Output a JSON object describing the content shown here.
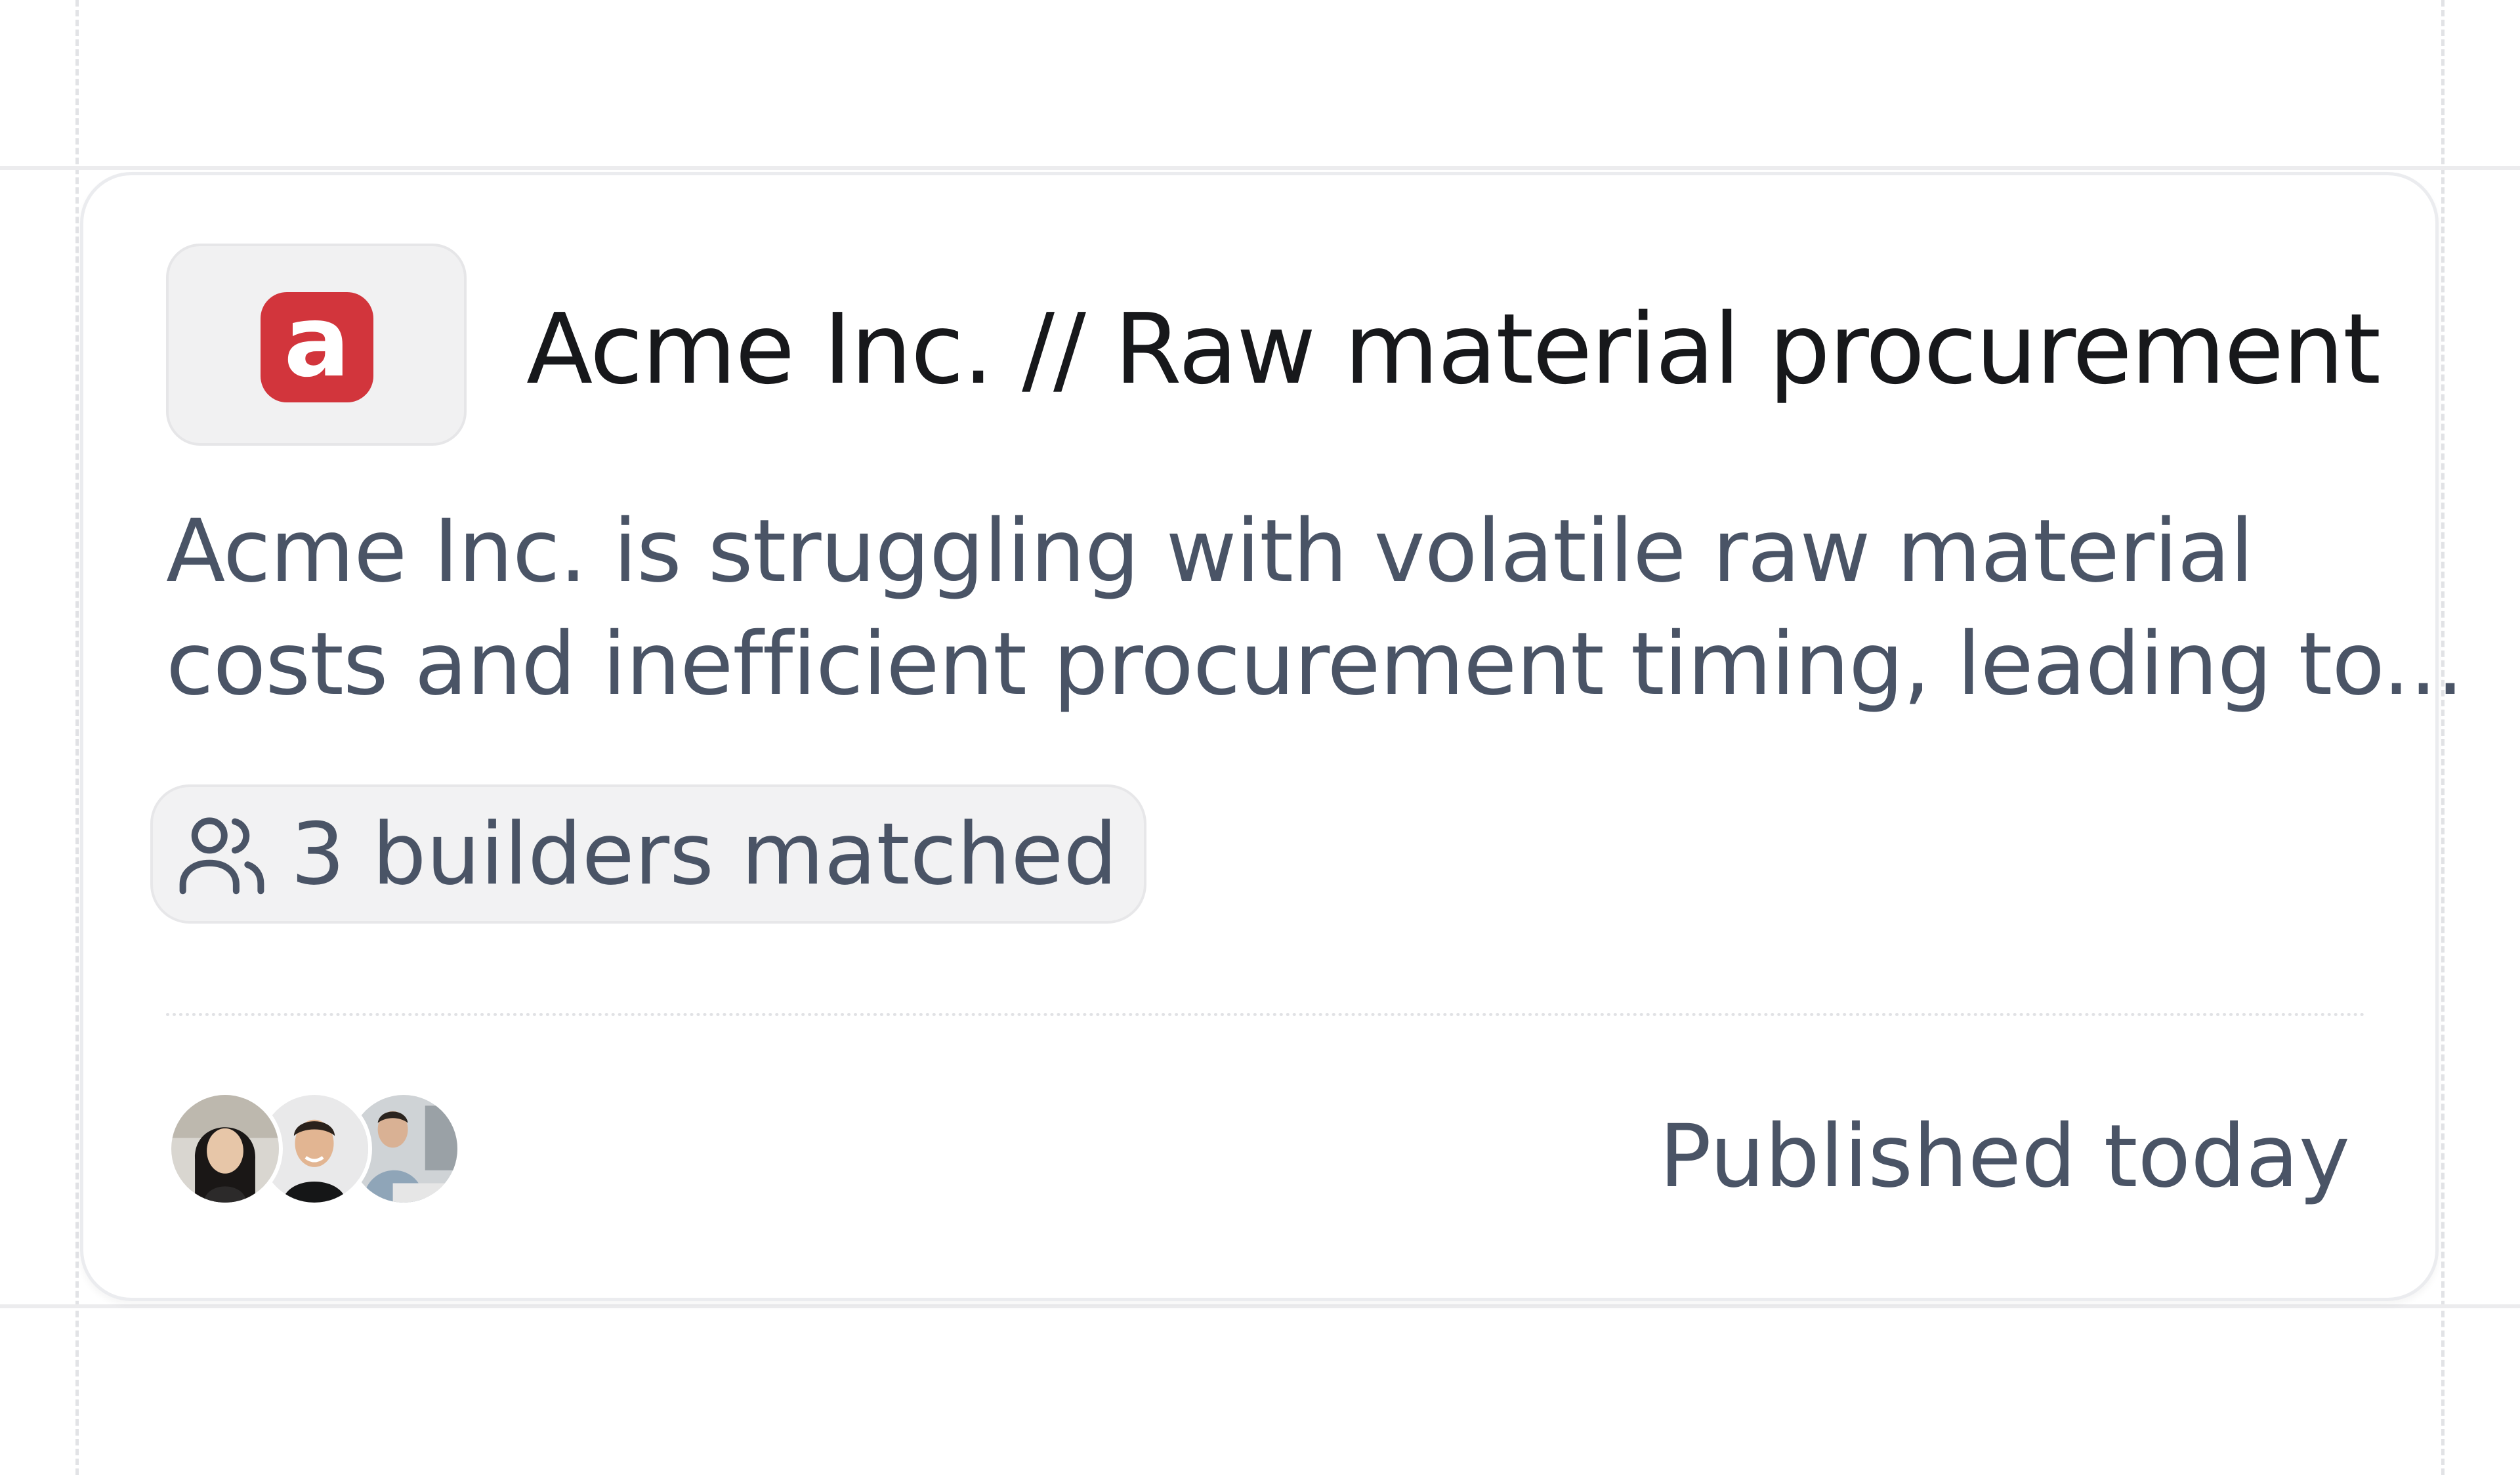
{
  "card": {
    "title": "Acme Inc. // Raw material procurement",
    "logo": {
      "letter": "a",
      "color": "#d2353c",
      "icon": "acme-logo-icon"
    },
    "description": {
      "line1": "Acme Inc. is struggling with volatile raw material",
      "line2": "costs and inefficient procurement timing, leading to..."
    },
    "match": {
      "icon": "users-icon",
      "label": "3 builders matched"
    },
    "avatars": [
      {
        "label": "builder avatar 1"
      },
      {
        "label": "builder avatar 2"
      },
      {
        "label": "builder avatar 3"
      }
    ],
    "published": "Published today"
  },
  "colors": {
    "title": "#17181b",
    "muted_text": "#4a5466",
    "pill_bg": "#f2f2f3",
    "card_border": "#ebecef"
  }
}
